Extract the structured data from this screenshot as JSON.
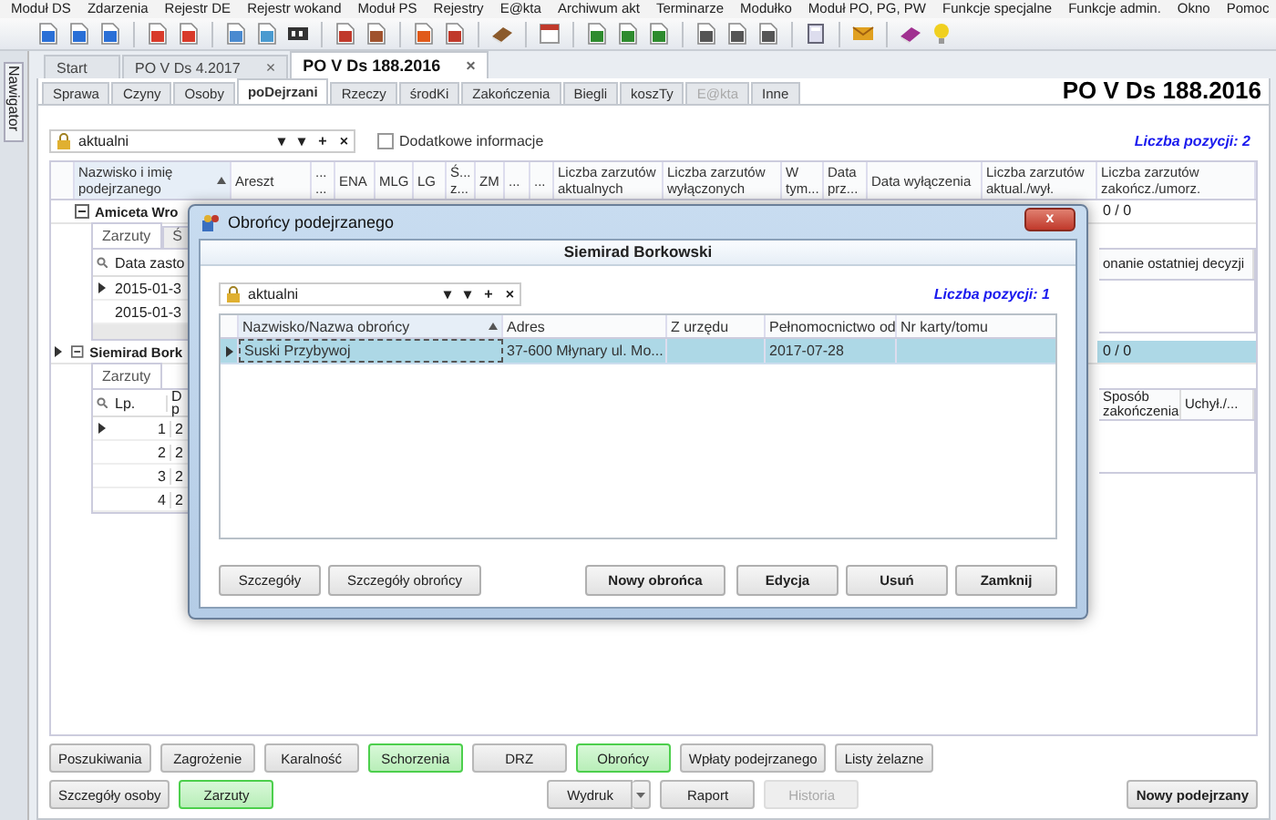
{
  "menu": [
    "Moduł DS",
    "Zdarzenia",
    "Rejestr DE",
    "Rejestr wokand",
    "Moduł PS",
    "Rejestry",
    "E@kta",
    "Archiwum akt",
    "Terminarze",
    "Modułko",
    "Moduł PO, PG, PW",
    "Funkcje specjalne",
    "Funkcje admin.",
    "Okno",
    "Pomoc"
  ],
  "sidebar": {
    "label": "Nawigator"
  },
  "doc_tabs": [
    {
      "label": "Start",
      "selected": false
    },
    {
      "label": "PO V Ds 4.2017",
      "close": "×",
      "selected": false
    },
    {
      "label": "PO V Ds 188.2016",
      "close": "×",
      "selected": true
    }
  ],
  "section_tabs": [
    {
      "label": "Sprawa",
      "selected": false,
      "disabled": false
    },
    {
      "label": "Czyny",
      "selected": false,
      "disabled": false
    },
    {
      "label": "Osoby",
      "selected": false,
      "disabled": false
    },
    {
      "label": "poDejrzani",
      "selected": true,
      "disabled": false
    },
    {
      "label": "Rzeczy",
      "selected": false,
      "disabled": false
    },
    {
      "label": "środKi",
      "selected": false,
      "disabled": false
    },
    {
      "label": "Zakończenia",
      "selected": false,
      "disabled": false
    },
    {
      "label": "Biegli",
      "selected": false,
      "disabled": false
    },
    {
      "label": "koszTy",
      "selected": false,
      "disabled": false
    },
    {
      "label": "E@kta",
      "selected": false,
      "disabled": true
    },
    {
      "label": "Inne",
      "selected": false,
      "disabled": false
    }
  ],
  "case_title": "PO V Ds 188.2016",
  "filter": {
    "value": "aktualni",
    "controls": [
      "▾",
      "▾",
      "+",
      "×"
    ]
  },
  "extra_info": {
    "label": "Dodatkowe informacje",
    "checked": false
  },
  "count": "Liczba pozycji: 2",
  "grid": {
    "columns": [
      {
        "label": "Nazwisko i imię podejrzanego",
        "sorted": true
      },
      {
        "label": "Areszt",
        "sorted": false
      },
      {
        "label": "... ...",
        "sorted": false
      },
      {
        "label": "ENA",
        "sorted": false
      },
      {
        "label": "MLG",
        "sorted": false
      },
      {
        "label": "LG",
        "sorted": false
      },
      {
        "label": "Ś... z...",
        "sorted": false
      },
      {
        "label": "ZM",
        "sorted": false
      },
      {
        "label": "...",
        "sorted": false
      },
      {
        "label": "...",
        "sorted": false
      },
      {
        "label": "Liczba zarzutów aktualnych",
        "sorted": false
      },
      {
        "label": "Liczba zarzutów wyłączonych",
        "sorted": false
      },
      {
        "label": "W tym...",
        "sorted": false
      },
      {
        "label": "Data prz...",
        "sorted": false
      },
      {
        "label": "Data wyłączenia",
        "sorted": false
      },
      {
        "label": "Liczba zarzutów aktual./wył.",
        "sorted": false
      },
      {
        "label": "Liczba zarzutów zakończ./umorz.",
        "sorted": false
      }
    ],
    "rows": [
      {
        "name": "Amiceta Wro",
        "expanded": true,
        "selected": false,
        "last": "0 / 0",
        "detail": {
          "tabs": [
            {
              "label": "Zarzuty",
              "selected": true
            },
            {
              "label": "Ś",
              "selected": false
            }
          ],
          "left_columns": [
            "Data zasto"
          ],
          "left_rows": [
            [
              "2015-01-3"
            ],
            [
              "2015-01-3"
            ]
          ],
          "right_columns": [
            "onanie ostatniej decyzji"
          ]
        }
      },
      {
        "name": "Siemirad Bork",
        "expanded": true,
        "selected": true,
        "last": "0 / 0",
        "detail": {
          "tabs": [
            {
              "label": "Zarzuty",
              "selected": true
            }
          ],
          "left_columns": [
            "Lp.",
            "D p"
          ],
          "left_rows": [
            [
              "1",
              "2"
            ],
            [
              "2",
              "2"
            ],
            [
              "3",
              "2"
            ],
            [
              "4",
              "2"
            ]
          ],
          "right_columns": [
            "Sposób zakończenia",
            "Uchył./..."
          ]
        }
      }
    ]
  },
  "buttons_row1": [
    {
      "label": "Poszukiwania",
      "highlighted": false,
      "disabled": false
    },
    {
      "label": "Zagrożenie",
      "highlighted": false,
      "disabled": false
    },
    {
      "label": "Karalność",
      "highlighted": false,
      "disabled": false
    },
    {
      "label": "Schorzenia",
      "highlighted": true,
      "disabled": false
    },
    {
      "label": "DRZ",
      "highlighted": false,
      "disabled": false
    },
    {
      "label": "Obrońcy",
      "highlighted": true,
      "disabled": false
    },
    {
      "label": "Wpłaty podejrzanego",
      "highlighted": false,
      "disabled": false
    },
    {
      "label": "Listy żelazne",
      "highlighted": false,
      "disabled": false
    }
  ],
  "buttons_row2_left": [
    {
      "label": "Szczegóły osoby",
      "highlighted": false,
      "disabled": false
    },
    {
      "label": "Zarzuty",
      "highlighted": true,
      "disabled": false
    }
  ],
  "buttons_row2_mid": [
    {
      "label": "Wydruk",
      "kind": "split",
      "highlighted": false,
      "disabled": false
    },
    {
      "label": "Raport",
      "kind": "plain",
      "highlighted": false,
      "disabled": false
    },
    {
      "label": "Historia",
      "kind": "plain",
      "highlighted": false,
      "disabled": true
    }
  ],
  "new_button": {
    "label": "Nowy podejrzany"
  },
  "dialog": {
    "title": "Obrońcy podejrzanego",
    "close": "x",
    "person": "Siemirad Borkowski",
    "filter": {
      "value": "aktualni",
      "controls": [
        "▾",
        "▾",
        "+",
        "×"
      ]
    },
    "count": "Liczba pozycji: 1",
    "columns": [
      {
        "label": "Nazwisko/Nazwa obrońcy",
        "sorted": true
      },
      {
        "label": "Adres",
        "sorted": false
      },
      {
        "label": "Z urzędu",
        "sorted": false
      },
      {
        "label": "Pełnomocnictwo od",
        "sorted": false
      },
      {
        "label": "Nr karty/tomu",
        "sorted": false
      }
    ],
    "rows": [
      {
        "selected": true,
        "name": "Suski Przybywoj",
        "address": "37-600 Młynary ul. Mo...",
        "since": "2017-07-28"
      }
    ],
    "buttons_left": [
      "Szczegóły",
      "Szczegóły obrońcy"
    ],
    "buttons_right": [
      "Nowy obrońca",
      "Edycja",
      "Usuń",
      "Zamknij"
    ]
  }
}
